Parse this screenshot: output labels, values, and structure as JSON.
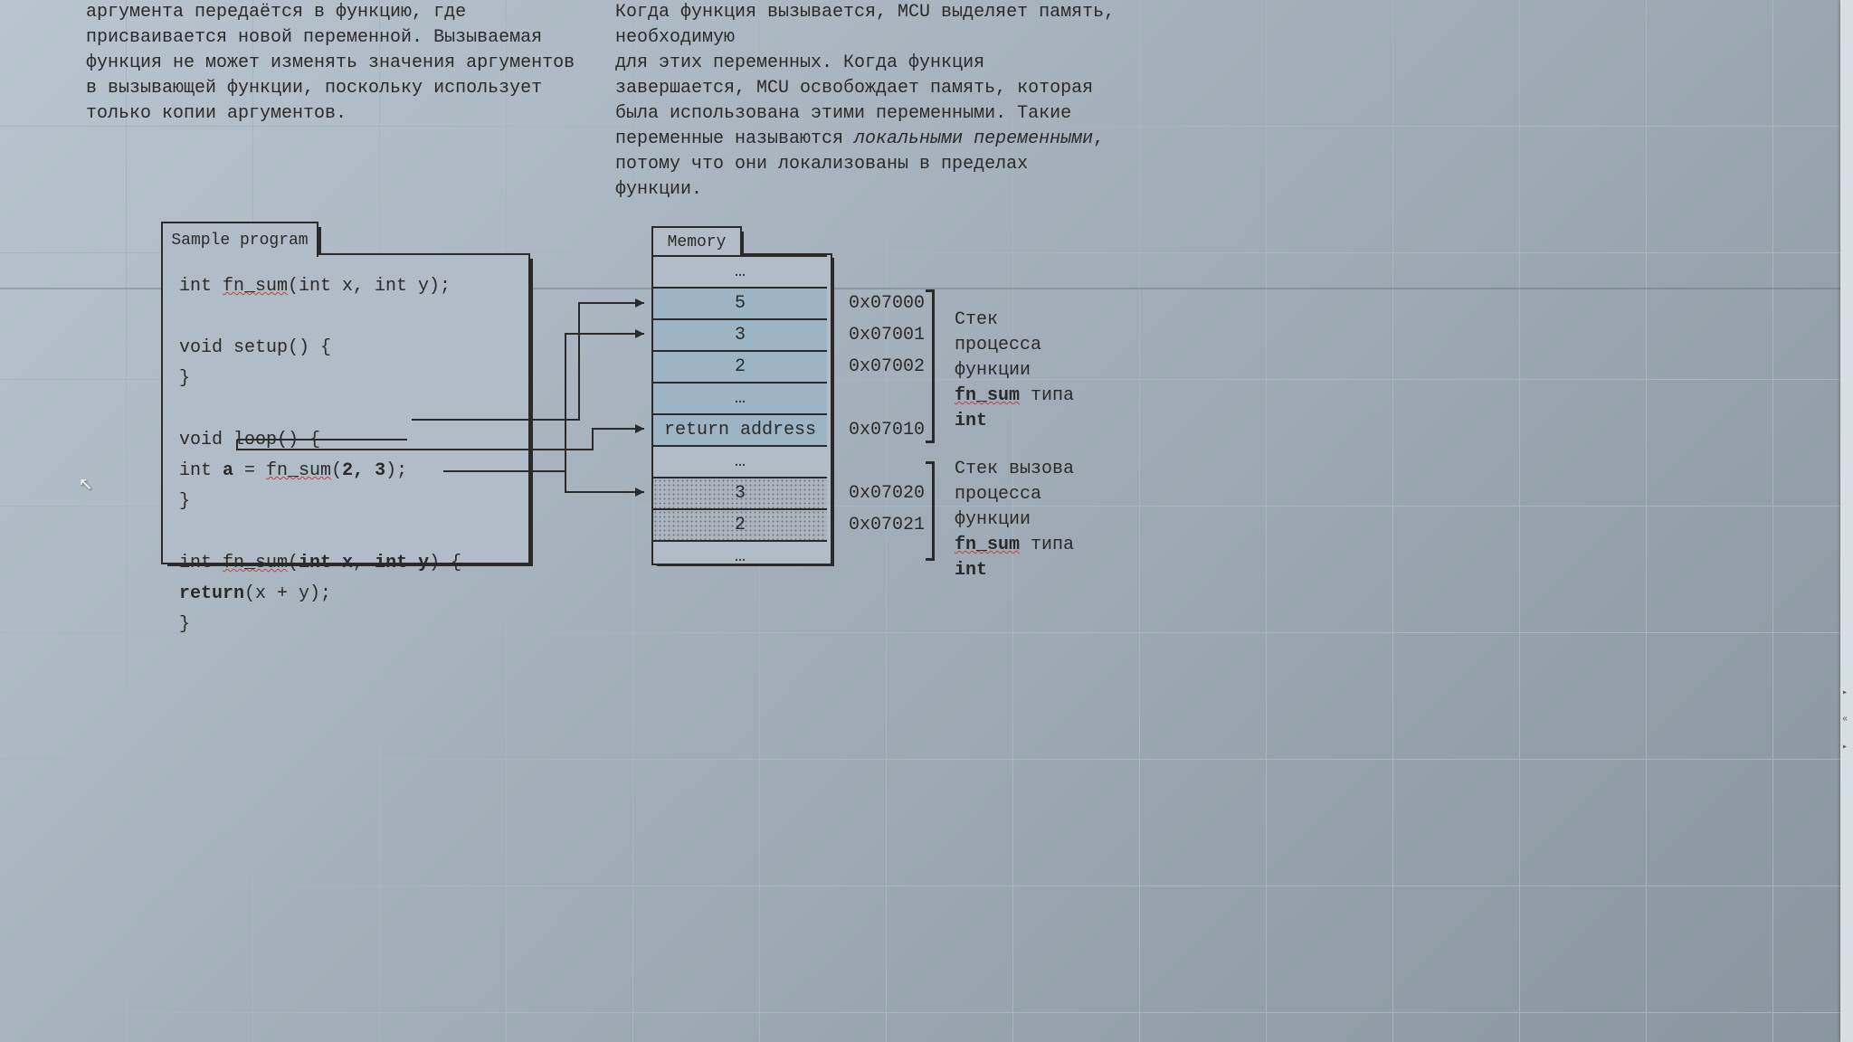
{
  "text": {
    "left_paragraph": "аргумента передаётся в функцию, где присваивается новой переменной. Вызываемая функция не может изменять значения аргументов в вызывающей функции, поскольку использует только копии аргументов.",
    "right_top": "Когда функция вызывается, MCU выделяет память, необходимую",
    "right_line2": "для этих переменных. Когда функция завершается, MCU освобождает память, которая была использована этими переменными. Такие переменные называются ",
    "right_italic": "локальными переменными",
    "right_line3": ", потому что они локализованы в пределах функции."
  },
  "program": {
    "tab": "Sample program",
    "line1_a": "int ",
    "line1_fn": "fn_sum",
    "line1_b": "(int x, int y);",
    "line3": "void setup() {",
    "line4": "}",
    "line6": "void loop() {",
    "line7a": "int ",
    "line7b": "a",
    "line7c": " = ",
    "line7fn": "fn_sum",
    "line7d": "(",
    "line7e": "2, 3",
    "line7f": ");",
    "line8": "}",
    "line10a": "int ",
    "line10fn": "fn_sum",
    "line10b": "(",
    "line10c": "int x",
    "line10d": ", ",
    "line10e": "int y",
    "line10f": ") {",
    "line11a": "return",
    "line11b": "(x + y);",
    "line12": "}"
  },
  "memory": {
    "tab": "Memory",
    "cells": [
      "…",
      "5",
      "3",
      "2",
      "…",
      "return address",
      "…",
      "3",
      "2",
      "…"
    ],
    "addresses": [
      "0x07000",
      "0x07001",
      "0x07002",
      "0x07010",
      "0x07020",
      "0x07021"
    ]
  },
  "stack1": {
    "l1": "Стек",
    "l2": "процесса",
    "l3": "функции",
    "fn": "fn_sum",
    "l4": " типа",
    "l5": "int"
  },
  "stack2": {
    "l1": "Стек вызова",
    "l2": "процесса",
    "l3": "функции",
    "fn": "fn_sum",
    "l4": " типа",
    "l5": "int"
  }
}
